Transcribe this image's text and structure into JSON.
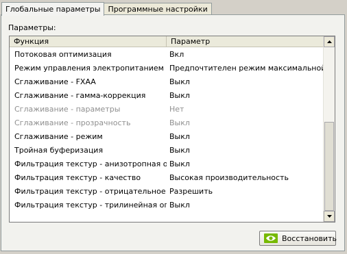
{
  "tabs": [
    {
      "label": "Глобальные параметры",
      "active": true
    },
    {
      "label": "Программные настройки",
      "active": false
    }
  ],
  "params_label": "Параметры:",
  "table": {
    "headers": [
      "Функция",
      "Параметр"
    ],
    "rows": [
      {
        "function": "Потоковая оптимизация",
        "value": "Вкл",
        "enabled": true
      },
      {
        "function": "Режим управления электропитанием",
        "value": "Предпочтителен режим максимальной п...",
        "enabled": true
      },
      {
        "function": "Сглаживание - FXAA",
        "value": "Выкл",
        "enabled": true
      },
      {
        "function": "Сглаживание - гамма-коррекция",
        "value": "Выкл",
        "enabled": true
      },
      {
        "function": "Сглаживание - параметры",
        "value": "Нет",
        "enabled": false
      },
      {
        "function": "Сглаживание - прозрачность",
        "value": "Выкл",
        "enabled": false
      },
      {
        "function": "Сглаживание - режим",
        "value": "Выкл",
        "enabled": true
      },
      {
        "function": "Тройная буферизация",
        "value": "Выкл",
        "enabled": true
      },
      {
        "function": "Фильтрация текстур - анизотропная оп...",
        "value": "Выкл",
        "enabled": true
      },
      {
        "function": "Фильтрация текстур - качество",
        "value": "Высокая производительность",
        "enabled": true
      },
      {
        "function": "Фильтрация текстур - отрицательное о...",
        "value": "Разрешить",
        "enabled": true
      },
      {
        "function": "Фильтрация текстур - трилинейная опт...",
        "value": "Выкл",
        "enabled": true
      }
    ]
  },
  "buttons": {
    "restore": "Восстановить",
    "restore_icon": "nvidia-logo-icon"
  },
  "colors": {
    "nvidia_green": "#76b900",
    "disabled_text": "#8f8f8f"
  }
}
